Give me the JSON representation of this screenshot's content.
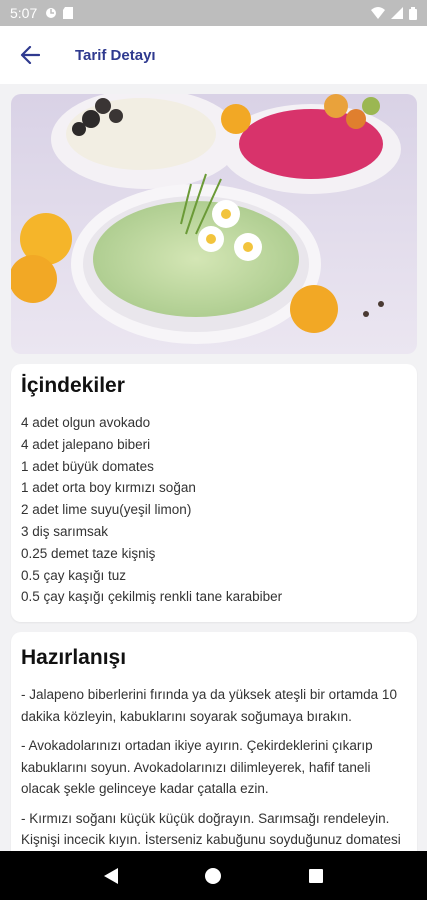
{
  "status_bar": {
    "time": "5:07",
    "icons": [
      "signal-icon",
      "wifi-icon",
      "battery-icon"
    ]
  },
  "header": {
    "title": "Tarif Detayı",
    "back_icon": "arrow-left-icon"
  },
  "ingredients": {
    "title": "İçindekiler",
    "items": [
      "4 adet olgun avokado",
      "4 adet jalepano biberi",
      "1 adet büyük domates",
      "1 adet orta boy kırmızı soğan",
      "2 adet lime suyu(yeşil limon)",
      "3 diş sarımsak",
      "0.25 demet taze kişniş",
      "0.5 çay kaşığı tuz",
      "0.5 çay kaşığı çekilmiş renkli tane karabiber"
    ]
  },
  "preparation": {
    "title": "Hazırlanışı",
    "steps": [
      "- Jalapeno biberlerini fırında ya da yüksek ateşli bir ortamda 10 dakika közleyin, kabuklarını soyarak soğumaya bırakın.",
      "- Avokadolarınızı ortadan ikiye ayırın. Çekirdeklerini çıkarıp kabuklarını soyun. Avokadolarınızı dilimleyerek, hafif taneli olacak şekle gelinceye kadar çatalla ezin.",
      "- Kırmızı soğanı küçük küçük doğrayın. Sarımsağı rendeleyin. Kişnişi incecik kıyın. İsterseniz kabuğunu soyduğunuz domatesi küçük küpler halinde kesebilirsiniz."
    ]
  },
  "nav": {
    "back": "back-triangle-icon",
    "home": "home-circle-icon",
    "recents": "recents-square-icon"
  }
}
